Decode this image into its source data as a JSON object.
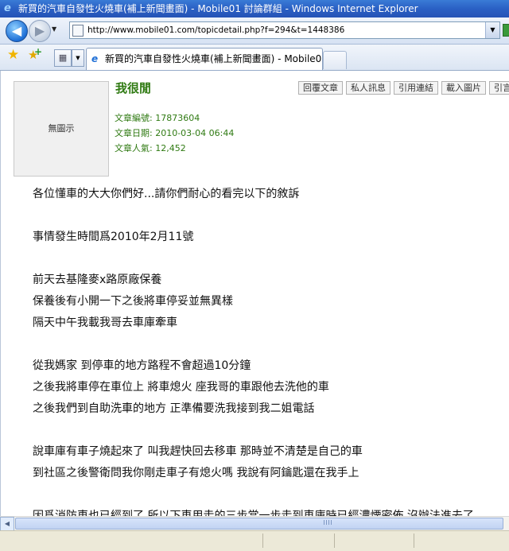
{
  "window": {
    "title": "新買的汽車自發性火燒車(補上新聞畫面) - Mobile01 討論群組 - Windows Internet Explorer"
  },
  "toolbar": {
    "back_glyph": "◀",
    "forward_glyph": "▶",
    "address_url": "http://www.mobile01.com/topicdetail.php?f=294&t=1448386"
  },
  "tabs": {
    "active_label": "新買的汽車自發性火燒車(補上新聞畫面) - Mobile0..."
  },
  "post": {
    "avatar_placeholder": "無圖示",
    "username": "我很閒",
    "article_id": "文章編號: 17873604",
    "article_date": "文章日期: 2010-03-04 06:44",
    "article_views": "文章人氣: 12,452",
    "actions": [
      "回覆文章",
      "私人訊息",
      "引用連結",
      "載入圖片",
      "引言"
    ],
    "lines": [
      "各位懂車的大大你們好...請你們耐心的看完以下的敘訴",
      "",
      "事情發生時間爲2010年2月11號",
      "",
      "前天去基隆麥x路原廠保養",
      "保養後有小開一下之後將車停妥並無異樣",
      "隔天中午我載我哥去車庫牽車",
      "",
      "從我媽家 到停車的地方路程不會超過10分鐘",
      "之後我將車停在車位上 將車熄火 座我哥的車跟他去洗他的車",
      "之後我們到自助洗車的地方 正準備要洗我接到我二姐電話",
      "",
      "說車庫有車子燒起來了 叫我趕快回去移車 那時並不清楚是自己的車",
      "到社區之後警衛問我你剛走車子有熄火嗎 我說有阿鑰匙還在我手上",
      "",
      "因爲消防車也已經到了 所以下車用走的三步當一步走到車庫時已經濃煙密佈 沒辦法進去了"
    ]
  },
  "colors": {
    "title_bar": "#2a60c4",
    "meta_text": "#2f7a12"
  }
}
